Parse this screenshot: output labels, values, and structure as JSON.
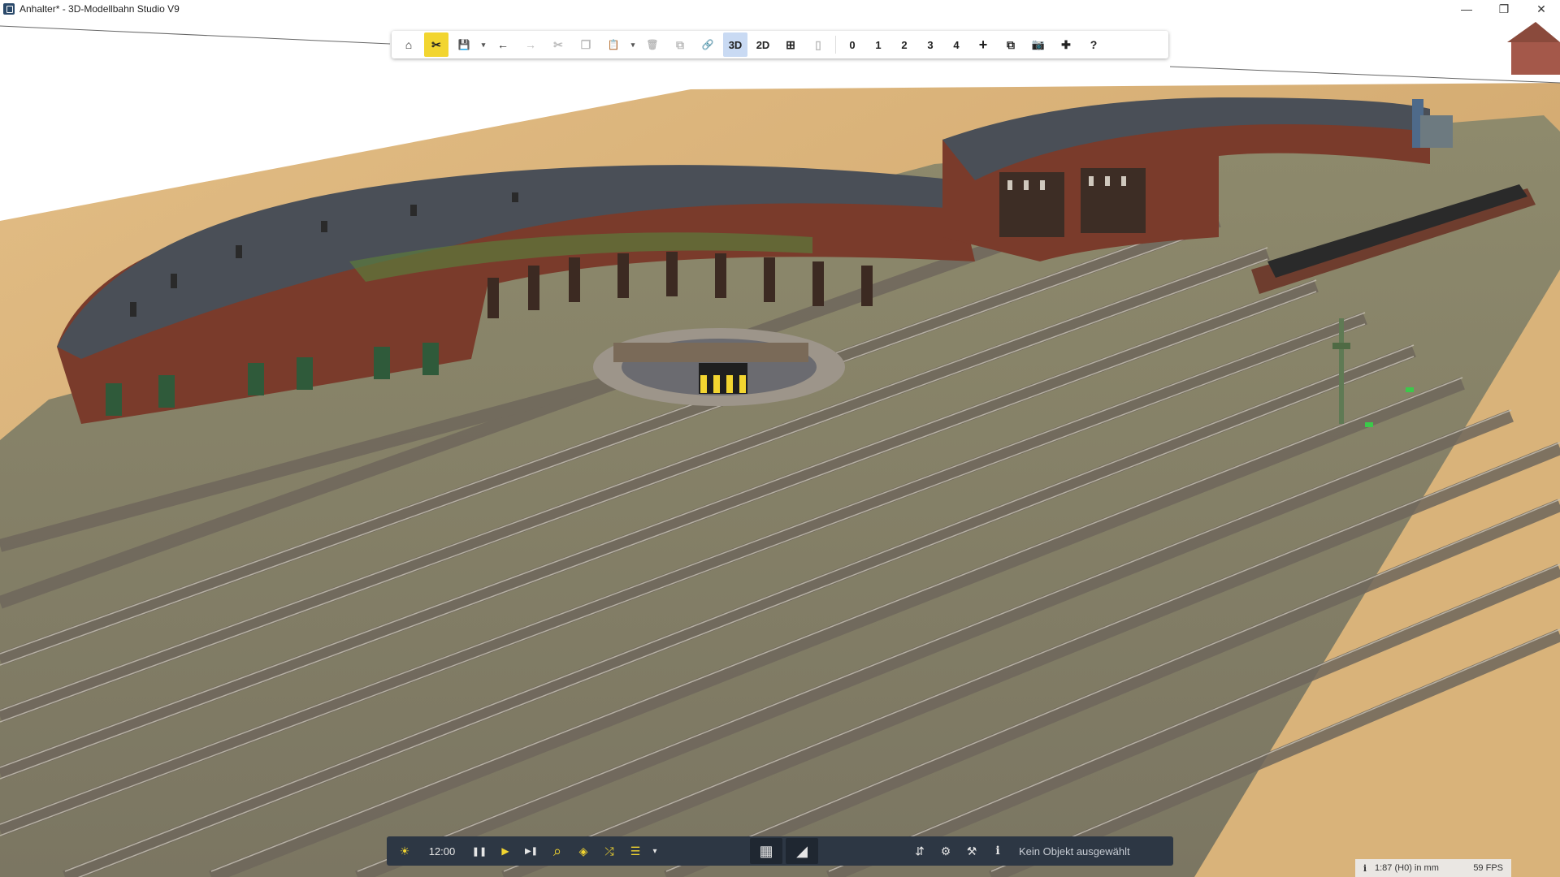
{
  "window": {
    "title": "Anhalter* - 3D-Modellbahn Studio V9",
    "minimize": "—",
    "maximize": "❐",
    "close": "✕"
  },
  "toolbar": {
    "home_icon": "⌂",
    "edit_icon": "✂",
    "save_icon": "💾",
    "dropdown_icon": "▾",
    "undo_icon": "←",
    "redo_icon": "→",
    "cut_icon": "✂",
    "copy_icon": "❐",
    "paste_icon": "📋",
    "delete_icon": "🗑",
    "group_icon": "⧉",
    "link_icon": "🔗",
    "view_3d": "3D",
    "view_2d": "2D",
    "grid_icon": "⊞",
    "train_icon": "▯",
    "layer_0": "0",
    "layer_1": "1",
    "layer_2": "2",
    "layer_3": "3",
    "layer_4": "4",
    "add_icon": "+",
    "window_icon": "⧉",
    "camera_icon": "📷",
    "plugin_icon": "✚",
    "help_icon": "?"
  },
  "bottombar": {
    "sun_icon": "☀",
    "time": "12:00",
    "pause_icon": "❚❚",
    "play_icon": "▶",
    "skip_icon": "▶❚",
    "search_icon": "⌕",
    "layers_icon": "◈",
    "shuffle_icon": "⤮",
    "list_icon": "☰",
    "dropdown_icon": "▾",
    "catalog_icon": "▦",
    "terrain_icon": "◢",
    "sliders_icon": "⇵",
    "settings_icon": "⚙",
    "tool_icon": "⚒",
    "info_icon": "i",
    "status_text": "Kein Objekt ausgewählt"
  },
  "status": {
    "info_icon": "i",
    "scale": "1:87 (H0) in mm",
    "fps": "59 FPS"
  },
  "colors": {
    "ground_sand": "#d8b27a",
    "ground_grass": "#8a8a6a",
    "sky": "#ffffff",
    "brick": "#7a3a2a",
    "roof": "#4a4f57",
    "accent_yellow": "#f2d530",
    "toolbar_dark": "#2d3744"
  }
}
